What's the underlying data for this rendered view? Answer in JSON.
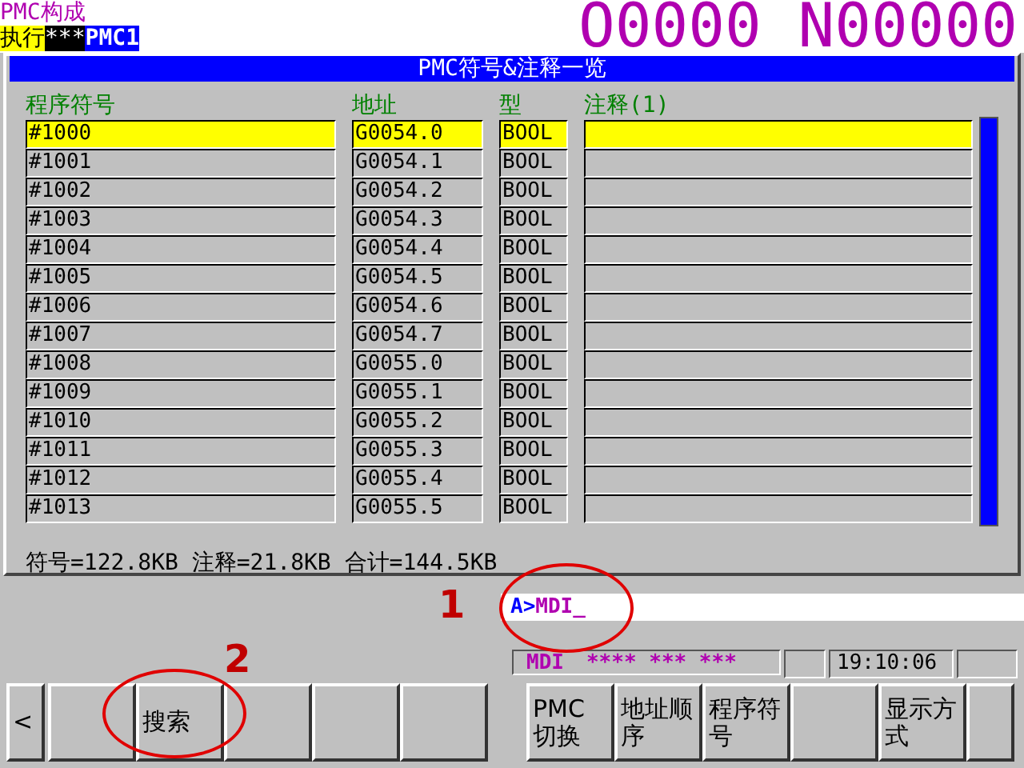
{
  "header": {
    "screen_title": "PMC构成",
    "mode": "执行",
    "status": "***",
    "path": "PMC1",
    "program_number": "O0000 N00000"
  },
  "panel": {
    "title": "PMC符号&注释一览",
    "columns": [
      "程序符号",
      "地址",
      "型",
      "注释(1)"
    ],
    "rows": [
      {
        "symbol": "#1000",
        "address": "G0054.0",
        "type": "BOOL",
        "selected": true
      },
      {
        "symbol": "#1001",
        "address": "G0054.1",
        "type": "BOOL",
        "selected": false
      },
      {
        "symbol": "#1002",
        "address": "G0054.2",
        "type": "BOOL",
        "selected": false
      },
      {
        "symbol": "#1003",
        "address": "G0054.3",
        "type": "BOOL",
        "selected": false
      },
      {
        "symbol": "#1004",
        "address": "G0054.4",
        "type": "BOOL",
        "selected": false
      },
      {
        "symbol": "#1005",
        "address": "G0054.5",
        "type": "BOOL",
        "selected": false
      },
      {
        "symbol": "#1006",
        "address": "G0054.6",
        "type": "BOOL",
        "selected": false
      },
      {
        "symbol": "#1007",
        "address": "G0054.7",
        "type": "BOOL",
        "selected": false
      },
      {
        "symbol": "#1008",
        "address": "G0055.0",
        "type": "BOOL",
        "selected": false
      },
      {
        "symbol": "#1009",
        "address": "G0055.1",
        "type": "BOOL",
        "selected": false
      },
      {
        "symbol": "#1010",
        "address": "G0055.2",
        "type": "BOOL",
        "selected": false
      },
      {
        "symbol": "#1011",
        "address": "G0055.3",
        "type": "BOOL",
        "selected": false
      },
      {
        "symbol": "#1012",
        "address": "G0055.4",
        "type": "BOOL",
        "selected": false
      },
      {
        "symbol": "#1013",
        "address": "G0055.5",
        "type": "BOOL",
        "selected": false
      }
    ],
    "summary": "符号=122.8KB 注释=21.8KB 合计=144.5KB"
  },
  "input_line": {
    "prompt": "A>",
    "value": "MDI_"
  },
  "status_bar": {
    "mode": "MDI",
    "flags": "**** *** ***",
    "time": "19:10:06"
  },
  "softkeys_left": [
    {
      "kind": "arrow",
      "label": "<"
    },
    {
      "kind": "blank"
    },
    {
      "kind": "text",
      "label": "搜索"
    },
    {
      "kind": "blank"
    },
    {
      "kind": "blank"
    },
    {
      "kind": "blank"
    }
  ],
  "softkeys_right": [
    {
      "kind": "text",
      "label": "PMC 切换"
    },
    {
      "kind": "text",
      "label": "地址顺序"
    },
    {
      "kind": "text",
      "label": "程序符号"
    },
    {
      "kind": "blank"
    },
    {
      "kind": "text",
      "label": "显示方式"
    },
    {
      "kind": "end"
    }
  ],
  "annotations": [
    {
      "label": "1"
    },
    {
      "label": "2"
    }
  ]
}
